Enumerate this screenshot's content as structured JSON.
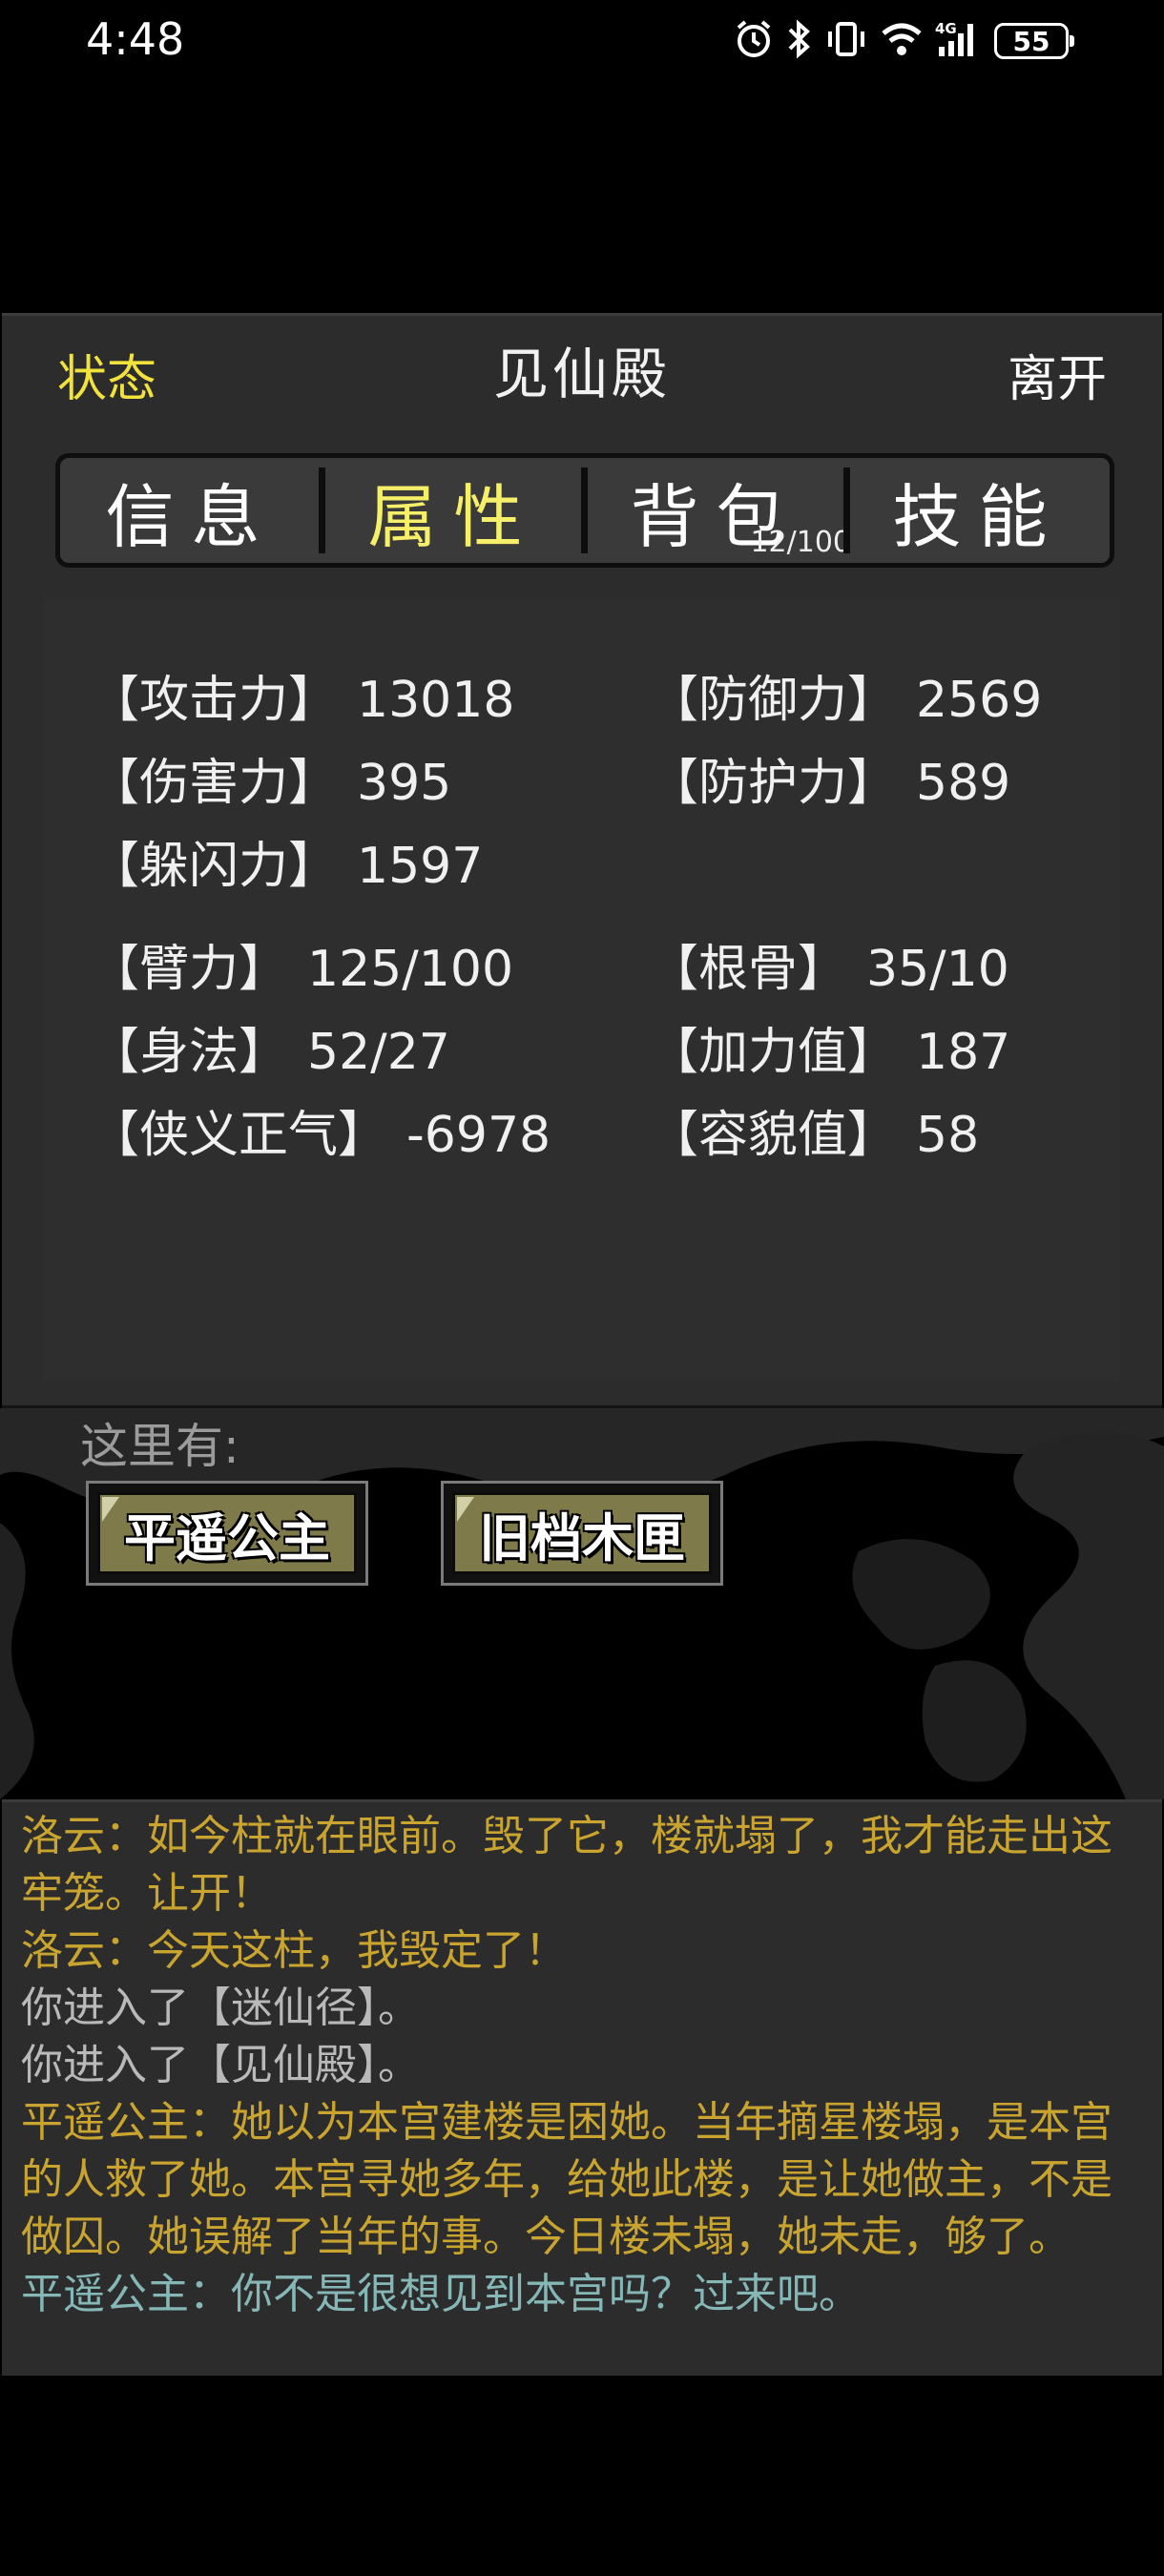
{
  "status_bar": {
    "time": "4:48",
    "battery": "55",
    "icons": [
      "alarm-icon",
      "bluetooth-icon",
      "vibrate-icon",
      "wifi-icon",
      "signal-4g-icon"
    ]
  },
  "header": {
    "status_label": "状态",
    "title": "见仙殿",
    "leave_label": "离开"
  },
  "tabs": [
    {
      "label": "信息",
      "active": false
    },
    {
      "label": "属性",
      "active": true
    },
    {
      "label": "背包",
      "active": false,
      "count": "12/100"
    },
    {
      "label": "技能",
      "active": false
    }
  ],
  "stats": {
    "attack": {
      "label": "【攻击力】",
      "value": "13018"
    },
    "defense": {
      "label": "【防御力】",
      "value": "2569"
    },
    "damage": {
      "label": "【伤害力】",
      "value": "395"
    },
    "protection": {
      "label": "【防护力】",
      "value": "589"
    },
    "dodge": {
      "label": "【躲闪力】",
      "value": "1597"
    },
    "arm": {
      "label": "【臂力】",
      "value": "125/100"
    },
    "bone": {
      "label": "【根骨】",
      "value": "35/10"
    },
    "agility": {
      "label": "【身法】",
      "value": "52/27"
    },
    "bonus": {
      "label": "【加力值】",
      "value": "187"
    },
    "chivalry": {
      "label": "【侠义正气】",
      "value": "-6978"
    },
    "looks": {
      "label": "【容貌值】",
      "value": "58"
    }
  },
  "scene": {
    "here_label": "这里有:",
    "entities": [
      {
        "label": "平遥公主"
      },
      {
        "label": "旧档木匣"
      }
    ]
  },
  "log": {
    "colors": {
      "gold": "#c9a530",
      "gray": "#b9b9b9",
      "teal": "#86b7b7"
    },
    "lines": [
      {
        "text": "洛云：如今柱就在眼前。毁了它，楼就塌了，我才能走出这牢笼。让开！",
        "color": "gold"
      },
      {
        "text": "洛云：今天这柱，我毁定了！",
        "color": "gold"
      },
      {
        "text": "你进入了【迷仙径】。",
        "color": "gray"
      },
      {
        "text": "你进入了【见仙殿】。",
        "color": "gray"
      },
      {
        "text": "平遥公主：她以为本宫建楼是困她。当年摘星楼塌，是本宫的人救了她。本宫寻她多年，给她此楼，是让她做主，不是做囚。她误解了当年的事。今日楼未塌，她未走，够了。",
        "color": "gold"
      },
      {
        "text": "平遥公主：你不是很想见到本宫吗？过来吧。",
        "color": "teal"
      }
    ]
  }
}
